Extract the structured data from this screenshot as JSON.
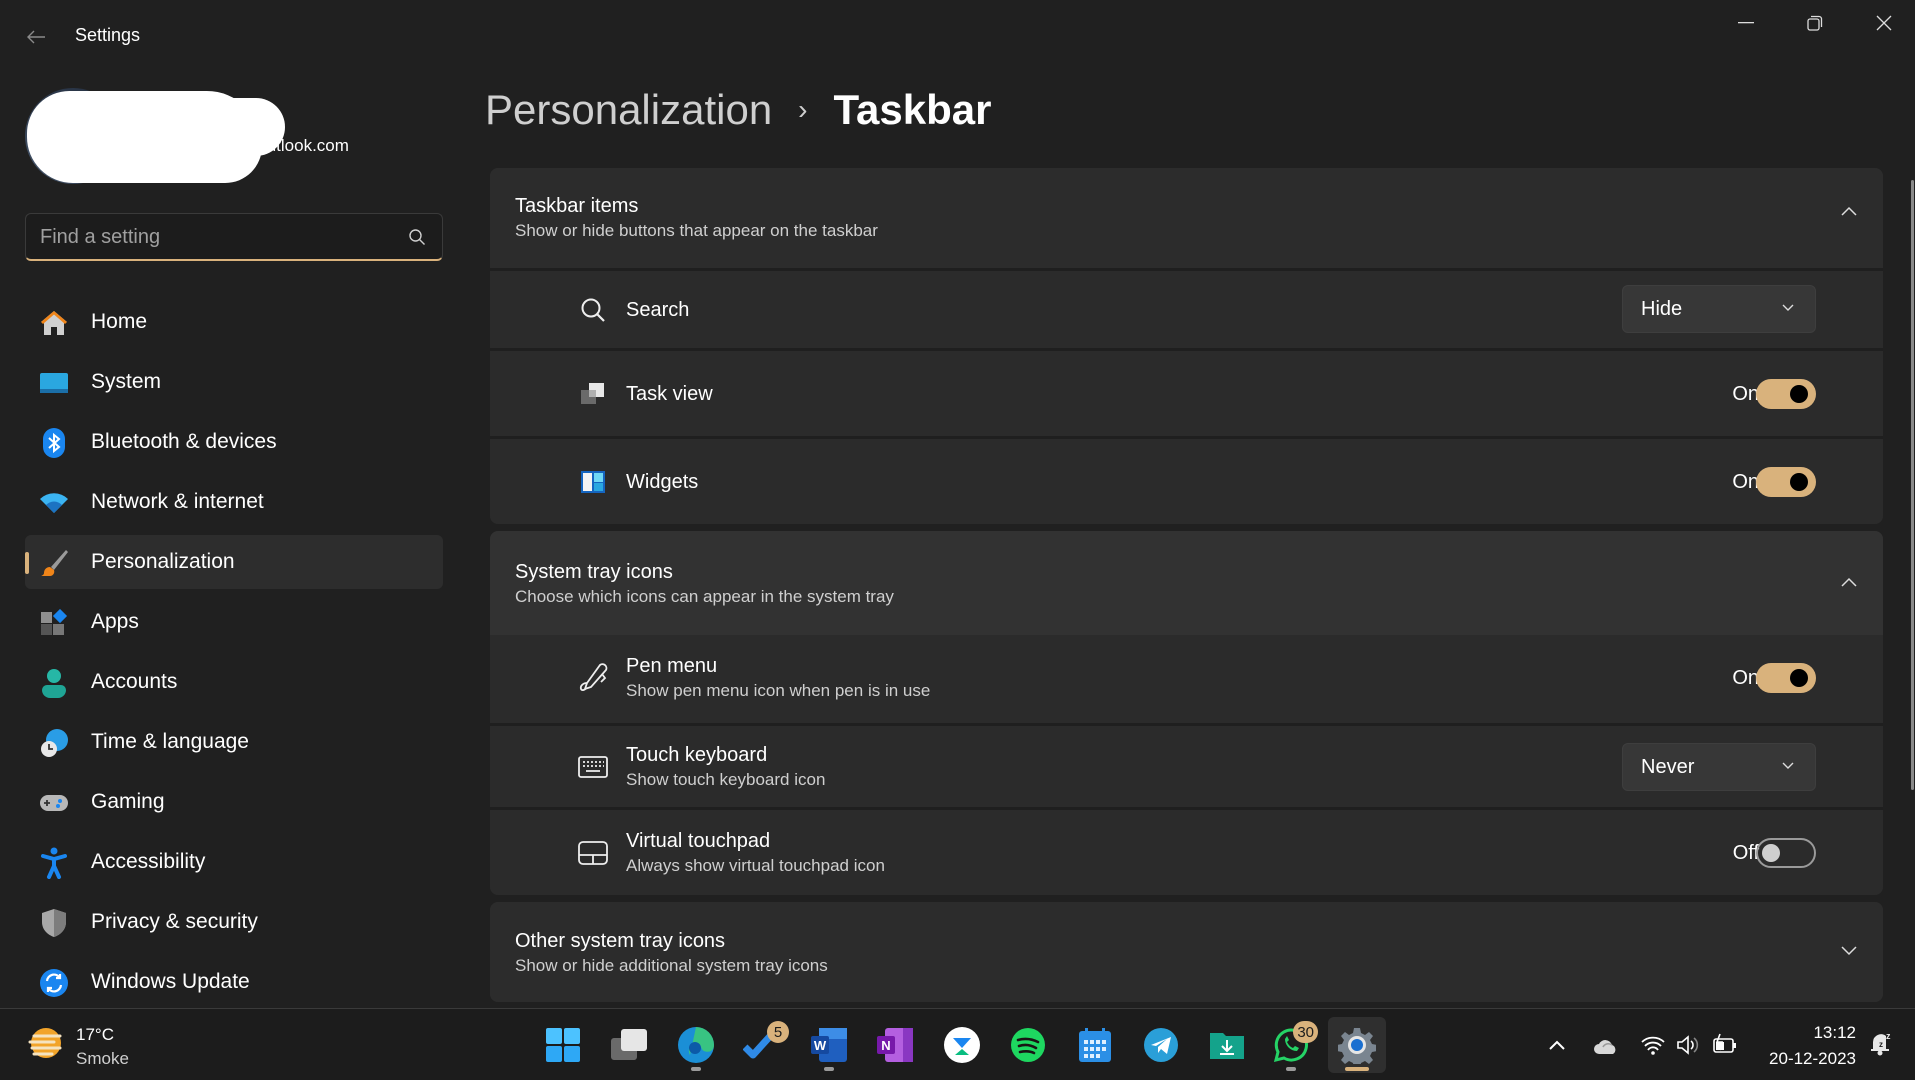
{
  "window": {
    "title": "Settings",
    "back_icon": "back-arrow-icon",
    "controls": [
      "minimize-icon",
      "maximize-icon",
      "close-icon"
    ]
  },
  "profile": {
    "email_suffix": "@outlook.com"
  },
  "search": {
    "placeholder": "Find a setting",
    "value": ""
  },
  "sidebar": {
    "items": [
      {
        "label": "Home",
        "icon": "home-icon",
        "active": false
      },
      {
        "label": "System",
        "icon": "system-icon",
        "active": false
      },
      {
        "label": "Bluetooth & devices",
        "icon": "bluetooth-icon",
        "active": false
      },
      {
        "label": "Network & internet",
        "icon": "wifi-icon",
        "active": false
      },
      {
        "label": "Personalization",
        "icon": "brush-icon",
        "active": true
      },
      {
        "label": "Apps",
        "icon": "apps-icon",
        "active": false
      },
      {
        "label": "Accounts",
        "icon": "person-icon",
        "active": false
      },
      {
        "label": "Time & language",
        "icon": "globe-clock-icon",
        "active": false
      },
      {
        "label": "Gaming",
        "icon": "gamepad-icon",
        "active": false
      },
      {
        "label": "Accessibility",
        "icon": "accessibility-icon",
        "active": false
      },
      {
        "label": "Privacy & security",
        "icon": "shield-icon",
        "active": false
      },
      {
        "label": "Windows Update",
        "icon": "update-icon",
        "active": false
      }
    ]
  },
  "breadcrumb": {
    "parent": "Personalization",
    "separator": "›",
    "current": "Taskbar"
  },
  "sections": {
    "taskbar_items": {
      "title": "Taskbar items",
      "description": "Show or hide buttons that appear on the taskbar",
      "expanded": true,
      "rows": [
        {
          "label": "Search",
          "icon": "search-icon",
          "control": "dropdown",
          "value": "Hide"
        },
        {
          "label": "Task view",
          "icon": "task-view-icon",
          "control": "toggle",
          "state": "On",
          "on": true
        },
        {
          "label": "Widgets",
          "icon": "widgets-icon",
          "control": "toggle",
          "state": "On",
          "on": true
        }
      ]
    },
    "system_tray": {
      "title": "System tray icons",
      "description": "Choose which icons can appear in the system tray",
      "expanded": true,
      "rows": [
        {
          "label": "Pen menu",
          "description": "Show pen menu icon when pen is in use",
          "icon": "pen-icon",
          "control": "toggle",
          "state": "On",
          "on": true
        },
        {
          "label": "Touch keyboard",
          "description": "Show touch keyboard icon",
          "icon": "keyboard-icon",
          "control": "dropdown",
          "value": "Never"
        },
        {
          "label": "Virtual touchpad",
          "description": "Always show virtual touchpad icon",
          "icon": "touchpad-icon",
          "control": "toggle",
          "state": "Off",
          "on": false
        }
      ]
    },
    "other_tray": {
      "title": "Other system tray icons",
      "description": "Show or hide additional system tray icons",
      "expanded": false
    }
  },
  "taskbar": {
    "weather": {
      "temperature": "17°C",
      "condition": "Smoke",
      "icon": "weather-smoke-icon"
    },
    "apps": [
      {
        "name": "Start",
        "icon": "windows-start-icon",
        "running": false
      },
      {
        "name": "Task View",
        "icon": "task-view-icon",
        "running": false
      },
      {
        "name": "Microsoft Edge",
        "icon": "edge-icon",
        "running": true
      },
      {
        "name": "Microsoft To Do",
        "icon": "todo-icon",
        "running": false,
        "badge": "5"
      },
      {
        "name": "Microsoft Word",
        "icon": "word-icon",
        "running": true
      },
      {
        "name": "OneNote",
        "icon": "onenote-icon",
        "running": false
      },
      {
        "name": "Unacademy",
        "icon": "unacademy-icon",
        "running": false
      },
      {
        "name": "Spotify",
        "icon": "spotify-icon",
        "running": false
      },
      {
        "name": "Calendar",
        "icon": "calendar-icon",
        "running": false
      },
      {
        "name": "Telegram",
        "icon": "telegram-icon",
        "running": false
      },
      {
        "name": "Downloads",
        "icon": "downloads-folder-icon",
        "running": false
      },
      {
        "name": "WhatsApp",
        "icon": "whatsapp-icon",
        "running": true,
        "badge": "30"
      },
      {
        "name": "Settings",
        "icon": "settings-gear-icon",
        "running": true,
        "active": true
      }
    ],
    "tray": {
      "icons": [
        "chevron-up-icon",
        "onedrive-icon",
        "wifi-icon",
        "volume-icon",
        "battery-charging-icon"
      ],
      "time": "13:12",
      "date": "20-12-2023",
      "notification_icon": "bell-snooze-icon"
    }
  },
  "colors": {
    "accent": "#d9b27c",
    "background": "#202020",
    "card": "#2b2b2b",
    "text": "#ffffff",
    "subtext": "#cfcfcf"
  }
}
